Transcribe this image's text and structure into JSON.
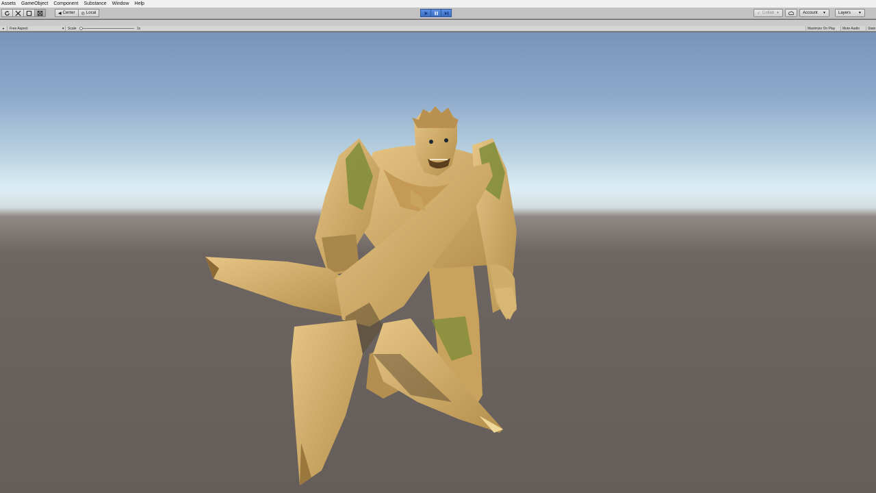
{
  "menu": [
    "Assets",
    "GameObject",
    "Component",
    "Substance",
    "Window",
    "Help"
  ],
  "toolbar": {
    "tools": [
      "refresh-icon",
      "move-icon",
      "rect-icon",
      "transform-icon"
    ],
    "pivot_label": "Center",
    "space_label": "Local",
    "play_controls": [
      "play-icon",
      "pause-icon",
      "step-icon"
    ],
    "collab_label": "Collab",
    "account_label": "Account",
    "layers_label": "Layers"
  },
  "game_view": {
    "aspect_label": "Free Aspect",
    "scale_label": "Scale",
    "scale_value": "1x",
    "maximize_label": "Maximize On Play",
    "mute_label": "Mute Audio",
    "stats_label": "Stats"
  },
  "colors": {
    "sky_top": "#7a94b9",
    "ground": "#655d59",
    "play_active": "#3d6fc4",
    "wood": "#d8b46e",
    "moss": "#7a8a35"
  }
}
